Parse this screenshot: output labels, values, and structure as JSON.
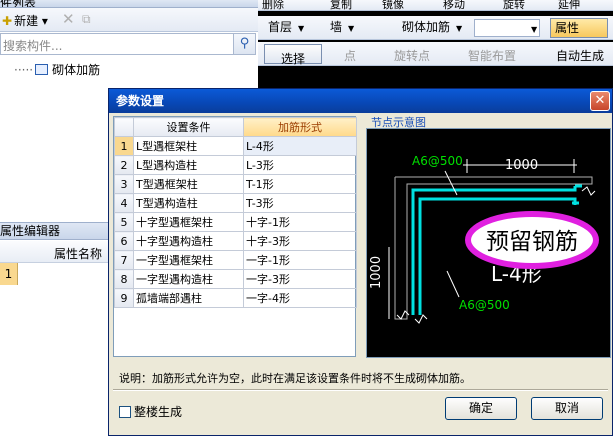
{
  "left_panel": {
    "header_title": "件列表",
    "header_tools": "↓ ✕",
    "new_button": "新建",
    "search_placeholder": "搜索构件...",
    "tree_item": "砌体加筋",
    "prop_editor_title": "属性编辑器",
    "prop_column": "属性名称",
    "prop_row_number": "1"
  },
  "top_toolbar": {
    "row1": [
      "删除",
      "复制",
      "镜像",
      "移动",
      "旋转",
      "延伸"
    ],
    "floor": "首层",
    "category": "墙",
    "component": "砌体加筋",
    "properties_button": "属性",
    "select_button": "选择",
    "point_button": "点",
    "rotate_point_button": "旋转点",
    "smart_layout_button": "智能布置",
    "auto_generate_button": "自动生成砌"
  },
  "dialog": {
    "title": "参数设置",
    "columns": [
      "设置条件",
      "加筋形式"
    ],
    "rows": [
      {
        "n": "1",
        "condition": "L型遇框架柱",
        "form": "L-4形"
      },
      {
        "n": "2",
        "condition": "L型遇构造柱",
        "form": "L-3形"
      },
      {
        "n": "3",
        "condition": "T型遇框架柱",
        "form": "T-1形"
      },
      {
        "n": "4",
        "condition": "T型遇构造柱",
        "form": "T-3形"
      },
      {
        "n": "5",
        "condition": "十字型遇框架柱",
        "form": "十字-1形"
      },
      {
        "n": "6",
        "condition": "十字型遇构造柱",
        "form": "十字-3形"
      },
      {
        "n": "7",
        "condition": "一字型遇框架柱",
        "form": "一字-1形"
      },
      {
        "n": "8",
        "condition": "一字型遇构造柱",
        "form": "一字-3形"
      },
      {
        "n": "9",
        "condition": "孤墙端部遇柱",
        "form": "一字-4形"
      }
    ],
    "diagram_label": "节点示意图",
    "diagram": {
      "rebar_top": "A6@500",
      "rebar_bottom": "A6@500",
      "dim_horizontal": "1000",
      "dim_vertical": "1000",
      "stamp_text": "预留钢筋",
      "shape_label": "L-4形"
    },
    "note": "说明：加筋形式允许为空，此时在满足该设置条件时将不生成砌体加筋。",
    "whole_floor_label": "整楼生成",
    "ok_button": "确定",
    "cancel_button": "取消",
    "colors": {
      "titlebar": "#0a4fc8",
      "rebar": "#00e0e0",
      "stamp": "#e020e0",
      "text_green": "#00e000"
    }
  }
}
